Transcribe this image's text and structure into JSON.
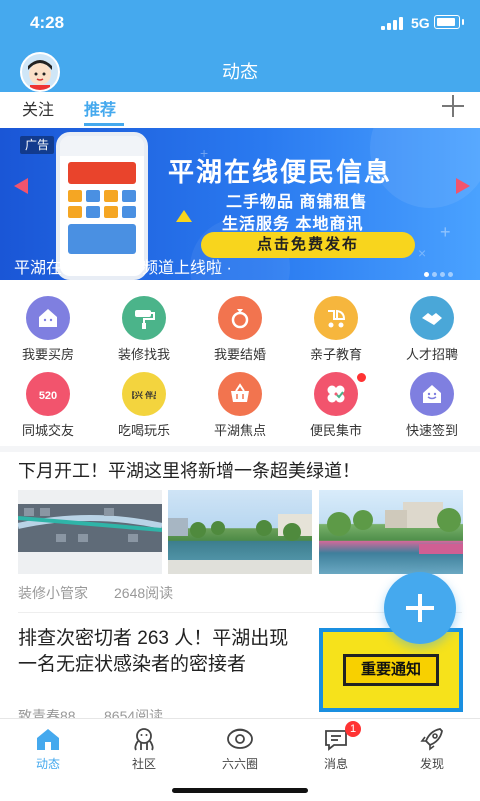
{
  "status_bar": {
    "time": "4:28",
    "network": "5G"
  },
  "header": {
    "title": "动态"
  },
  "tabs": [
    {
      "label": "关注"
    },
    {
      "label": "推荐"
    }
  ],
  "banner": {
    "ad_tag": "广告",
    "headline": "平湖在线便民信息",
    "line1": "二手物品 商铺租售",
    "line2": "生活服务 本地商讯",
    "cta": "点击免费发布",
    "caption": "平湖在线便民信息频道上线啦 ·"
  },
  "categories": [
    {
      "label": "我要买房",
      "color": "#7f7fe0",
      "icon": "house-icon"
    },
    {
      "label": "装修找我",
      "color": "#4bb48a",
      "icon": "paint-roller-icon"
    },
    {
      "label": "我要结婚",
      "color": "#f2744f",
      "icon": "ring-icon"
    },
    {
      "label": "亲子教育",
      "color": "#f6b63d",
      "icon": "stroller-icon"
    },
    {
      "label": "人才招聘",
      "color": "#4aa7d8",
      "icon": "handshake-icon"
    },
    {
      "label": "同城交友",
      "color": "#f2546d",
      "icon": "heart-520-icon",
      "art_text": "520"
    },
    {
      "label": "吃喝玩乐",
      "color": "#f3d43e",
      "icon": "food-icon",
      "art_text": "嘉兴 伴品"
    },
    {
      "label": "平湖焦点",
      "color": "#f2744f",
      "icon": "basket-icon"
    },
    {
      "label": "便民集市",
      "color": "#f2546d",
      "icon": "clover-icon"
    },
    {
      "label": "快速签到",
      "color": "#7f7fe0",
      "icon": "checkin-icon"
    }
  ],
  "articles": [
    {
      "title": "下月开工！平湖这里将新增一条超美绿道！",
      "author": "装修小管家",
      "reads": "2648阅读",
      "extra": "5"
    },
    {
      "title": "排查次密切者 263 人！平湖出现一名无症状感染者的密接者",
      "author": "致青春88",
      "reads": "8654阅读",
      "thumb_text": "重要通知"
    }
  ],
  "bottom_nav": [
    {
      "label": "动态",
      "icon": "home-icon",
      "active": true
    },
    {
      "label": "社区",
      "icon": "community-icon"
    },
    {
      "label": "六六圈",
      "icon": "circle-icon"
    },
    {
      "label": "消息",
      "icon": "message-icon",
      "badge": "1"
    },
    {
      "label": "发现",
      "icon": "rocket-icon"
    }
  ]
}
